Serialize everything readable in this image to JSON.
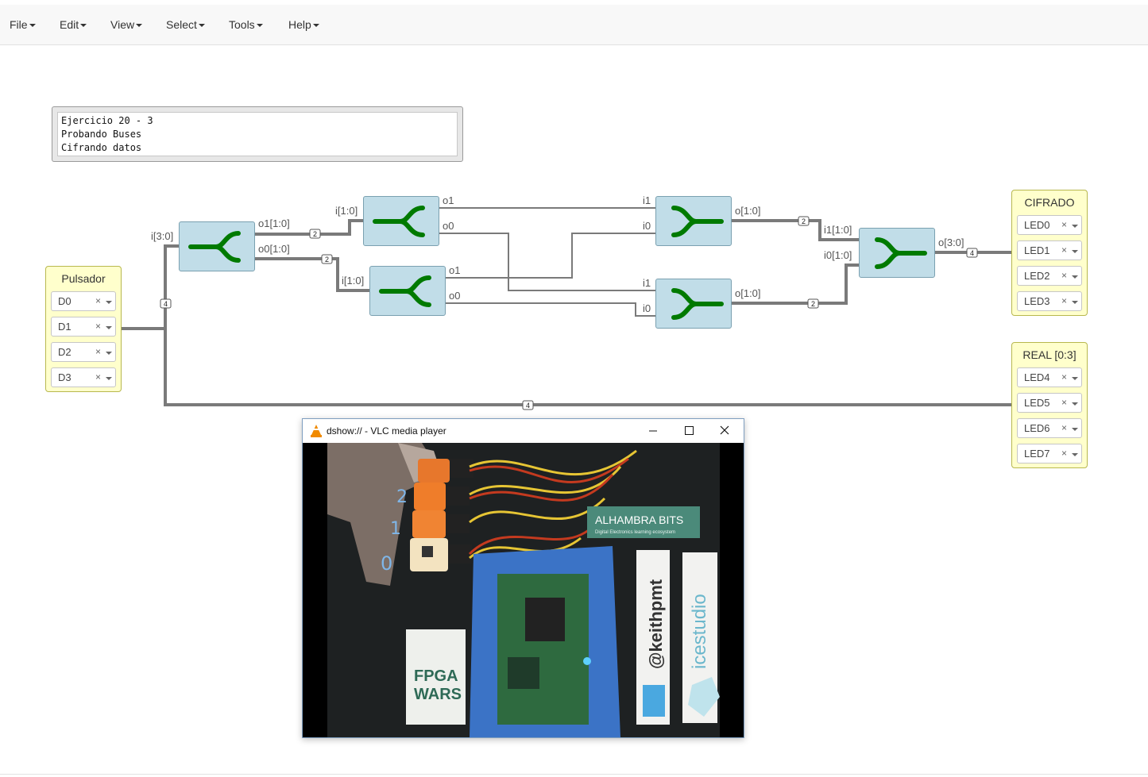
{
  "menu": {
    "items": [
      "File",
      "Edit",
      "View",
      "Select",
      "Tools",
      "Help"
    ]
  },
  "comment": {
    "lines": [
      "Ejercicio 20 - 3",
      "Probando Buses",
      "Cifrando datos"
    ]
  },
  "input_block": {
    "title": "Pulsador",
    "pins": [
      "D0",
      "D1",
      "D2",
      "D3"
    ],
    "remove_symbol": "×"
  },
  "output_cifrado": {
    "title": "CIFRADO",
    "pins": [
      "LED0",
      "LED1",
      "LED2",
      "LED3"
    ]
  },
  "output_real": {
    "title": "REAL [0:3]",
    "pins": [
      "LED4",
      "LED5",
      "LED6",
      "LED7"
    ]
  },
  "split_main": {
    "in": "i[3:0]",
    "out1": "o1[1:0]",
    "out0": "o0[1:0]"
  },
  "split_top": {
    "in": "i[1:0]",
    "out1": "o1",
    "out0": "o0"
  },
  "split_bottom": {
    "in": "i[1:0]",
    "out1": "o1",
    "out0": "o0"
  },
  "join_top": {
    "in1": "i1",
    "in0": "i0",
    "out": "o[1:0]"
  },
  "join_bottom": {
    "in1": "i1",
    "in0": "i0",
    "out": "o[1:0]"
  },
  "join_final": {
    "in1": "i1[1:0]",
    "in0": "i0[1:0]",
    "out": "o[3:0]"
  },
  "bus_widths": {
    "input_bus": "4",
    "o1_bus": "2",
    "o0_bus": "2",
    "join_top_out": "2",
    "join_bottom_out": "2",
    "cifrado_bus": "4",
    "real_bus": "4"
  },
  "colors": {
    "block_fill": "#c1dde8",
    "symbol_green": "#007a00",
    "io_fill": "#ffffcc",
    "wire": "#7a7a7a"
  },
  "vlc_window": {
    "title": "dshow:// - VLC media player",
    "minimize_icon": "minimize-icon",
    "maximize_icon": "maximize-icon",
    "close_icon": "close-icon",
    "video_text": {
      "alhambra": "ALHAMBRA BITS",
      "alhambra_sub": "Digital Electronics learning ecosystem",
      "fpga1": "FPGA",
      "fpga2": "WARS",
      "keith": "@keithpmt",
      "icestudio": "icestudio",
      "handwritten": [
        "2",
        "1",
        "0"
      ]
    }
  }
}
